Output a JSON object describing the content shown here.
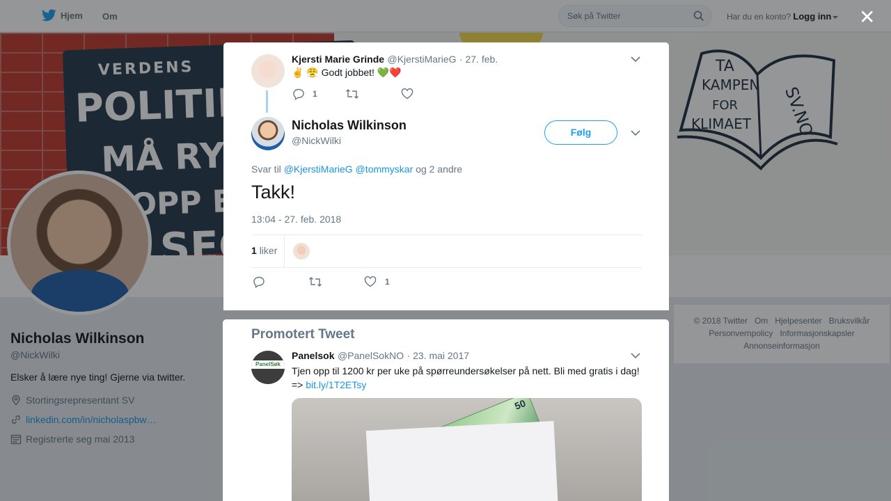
{
  "topbar": {
    "home_label": "Hjem",
    "about_label": "Om",
    "search_placeholder": "Søk på Twitter",
    "account_prompt": "Har du en konto?",
    "login_label": "Logg inn"
  },
  "banner": {
    "poster_line1": "VERDENS",
    "poster_line2": "POLITIKERE",
    "poster_line3": "MÅ RYDDE",
    "poster_line4": "OPP ETTER",
    "poster_line5": "SEG",
    "book_line1": "TA",
    "book_line2": "KAMPEN",
    "book_line3": "FOR",
    "book_line4": "KLIMAET",
    "book_line5": "SV.NO"
  },
  "profile": {
    "name": "Nicholas Wilkinson",
    "handle": "@NickWilki",
    "bio": "Elsker å lære nye ting! Gjerne via twitter.",
    "location": "Stortingsrepresentant SV",
    "website": "linkedin.com/in/nicholaspbw…",
    "joined": "Registrerte seg mai 2013"
  },
  "footer": {
    "copyright": "© 2018 Twitter",
    "about": "Om",
    "help": "Hjelpesenter",
    "terms": "Bruksvilkår",
    "privacy": "Personvernpolicy",
    "cookies": "Informasjonskapsler",
    "ads": "Annonseinformasjon"
  },
  "parent_tweet": {
    "name": "Kjersti Marie Grinde",
    "handle": "@KjerstiMarieG",
    "date": "· 27. feb.",
    "text": "✌️ 😤 Godt jobbet! 💚❤️",
    "reply_count": "1"
  },
  "main_tweet": {
    "name": "Nicholas Wilkinson",
    "handle": "@NickWilki",
    "follow_label": "Følg",
    "reply_prefix": "Svar til",
    "reply_user1": "@KjerstiMarieG",
    "reply_user2": "@tommyskar",
    "reply_suffix": "og 2 andre",
    "text": "Takk!",
    "timestamp": "13:04 - 27. feb. 2018",
    "likes_count": "1",
    "likes_label": "liker",
    "like_count_action": "1"
  },
  "promoted": {
    "heading": "Promotert Tweet",
    "name": "Panelsok",
    "handle": "@PanelSokNO",
    "date": "· 23. mai 2017",
    "text": "Tjen opp til 1200 kr per uke på spørreundersøkelser på nett. Bli med gratis i dag!",
    "arrow_prefix": "=>",
    "link": "bit.ly/1T2ETsy",
    "avatar_text": "PanelSøk",
    "note_value": "50"
  },
  "colors": {
    "accent": "#1da1f2",
    "link": "#1b95e0",
    "muted": "#657786",
    "like_red": "#e0245e",
    "overlay": "rgba(20,23,26,0.45)"
  }
}
